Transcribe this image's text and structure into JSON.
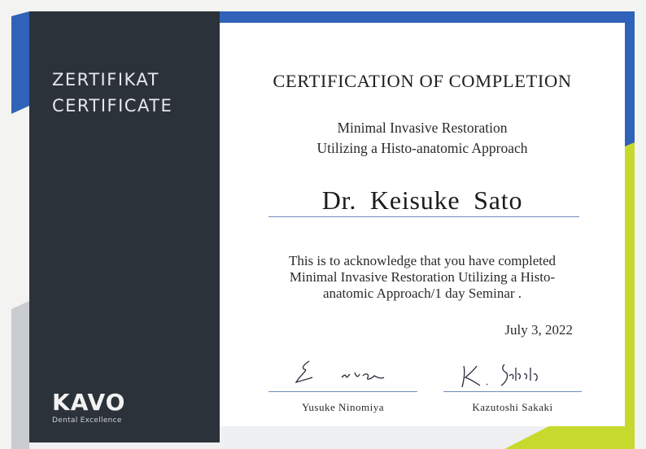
{
  "side": {
    "title_de": "ZERTIFIKAT",
    "title_en": "CERTIFICATE"
  },
  "logo": {
    "wordmark": "KAVO",
    "tagline": "Dental Excellence"
  },
  "certificate": {
    "heading": "CERTIFICATION OF COMPLETION",
    "course_line1": "Minimal Invasive Restoration",
    "course_line2": "Utilizing a Histo-anatomic Approach",
    "recipient": "Dr.  Keisuke  Sato",
    "body_line1": "This is to acknowledge that you have completed",
    "body_line2": "Minimal Invasive Restoration Utilizing a Histo-",
    "body_line3": "anatomic Approach/1 day Seminar .",
    "date": "July 3, 2022"
  },
  "signatures": [
    {
      "name": "Yusuke  Ninomiya"
    },
    {
      "name": "Kazutoshi  Sakaki"
    }
  ],
  "colors": {
    "blue_accent": "#2f62b8",
    "lime_accent": "#c8d92e",
    "panel": "#2b323a"
  }
}
